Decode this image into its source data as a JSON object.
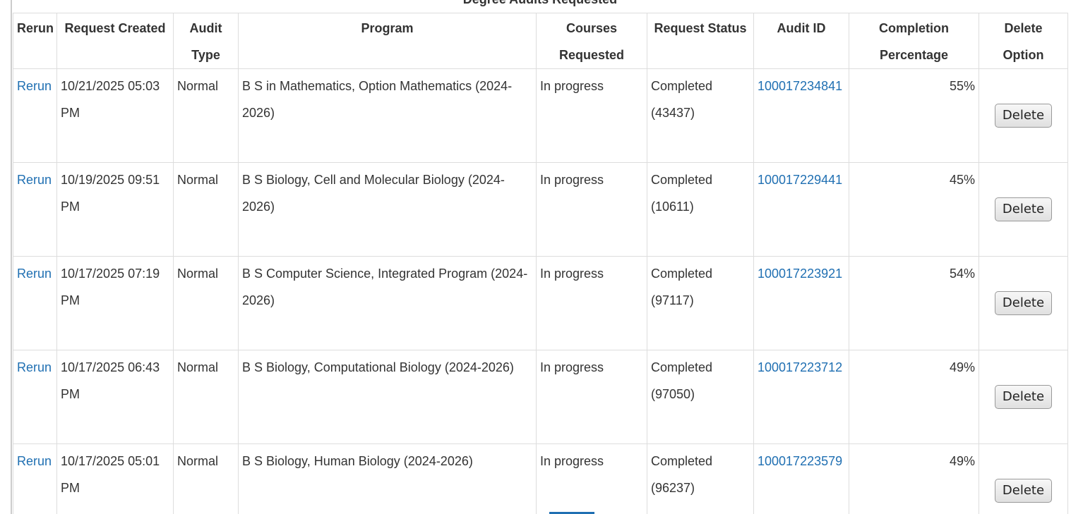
{
  "caption": "Degree Audits Requested",
  "headers": {
    "rerun": "Rerun",
    "request_created": "Request Created",
    "audit_type": "Audit Type",
    "program": "Program",
    "courses_requested": "Courses Requested",
    "request_status": "Request Status",
    "audit_id": "Audit ID",
    "completion_percentage": "Completion Percentage",
    "delete_option": "Delete Option"
  },
  "rows": [
    {
      "rerun": "Rerun",
      "request_created": "10/21/2025 05:03 PM",
      "audit_type": "Normal",
      "program": "B S in Mathematics, Option Mathematics (2024-2026)",
      "courses_requested": "In progress",
      "request_status": "Completed (43437)",
      "audit_id": "100017234841",
      "completion_percentage": "55%",
      "delete": "Delete"
    },
    {
      "rerun": "Rerun",
      "request_created": "10/19/2025 09:51 PM",
      "audit_type": "Normal",
      "program": "B S Biology, Cell and Molecular Biology (2024-2026)",
      "courses_requested": "In progress",
      "request_status": "Completed (10611)",
      "audit_id": "100017229441",
      "completion_percentage": "45%",
      "delete": "Delete"
    },
    {
      "rerun": "Rerun",
      "request_created": "10/17/2025 07:19 PM",
      "audit_type": "Normal",
      "program": "B S Computer Science, Integrated Program (2024-2026)",
      "courses_requested": "In progress",
      "request_status": "Completed (97117)",
      "audit_id": "100017223921",
      "completion_percentage": "54%",
      "delete": "Delete"
    },
    {
      "rerun": "Rerun",
      "request_created": "10/17/2025 06:43 PM",
      "audit_type": "Normal",
      "program": "B S Biology, Computational Biology (2024-2026)",
      "courses_requested": "In progress",
      "request_status": "Completed (97050)",
      "audit_id": "100017223712",
      "completion_percentage": "49%",
      "delete": "Delete"
    },
    {
      "rerun": "Rerun",
      "request_created": "10/17/2025 05:01 PM",
      "audit_type": "Normal",
      "program": "B S Biology, Human Biology (2024-2026)",
      "courses_requested": "In progress",
      "request_status": "Completed (96237)",
      "audit_id": "100017223579",
      "completion_percentage": "49%",
      "delete": "Delete"
    }
  ],
  "colors": {
    "link": "#1f6fb2",
    "text": "#333333",
    "border": "#dddddd"
  }
}
